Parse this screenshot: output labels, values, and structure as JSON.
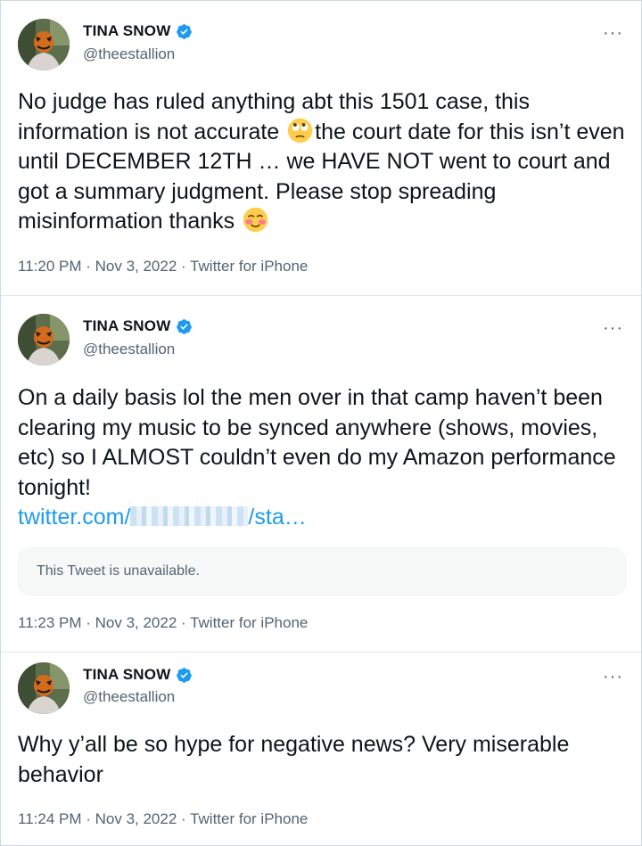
{
  "tweets": [
    {
      "name": "TINA SNOW",
      "handle": "@theestallion",
      "text_parts": [
        "No judge has ruled anything abt this 1501 case, this information is not accurate ",
        "the court date for this isn’t even until DECEMBER 12TH … we HAVE NOT went to court and got a summary judgment. Please stop spreading misinformation thanks "
      ],
      "emojis": [
        "eye-roll-emoji",
        "smiling-blush-emoji"
      ],
      "meta": "11:20 PM · Nov 3, 2022 · Twitter for iPhone"
    },
    {
      "name": "TINA SNOW",
      "handle": "@theestallion",
      "text": "On a daily basis lol the men over in that camp haven’t been clearing my music to be synced anywhere (shows, movies, etc) so I ALMOST couldn’t even do my Amazon performance tonight!",
      "link_prefix": "twitter.com/",
      "link_suffix": "/sta…",
      "quoted": "This Tweet is unavailable.",
      "meta": "11:23 PM · Nov 3, 2022 · Twitter for iPhone"
    },
    {
      "name": "TINA SNOW",
      "handle": "@theestallion",
      "text": "Why y’all be so hype for negative news? Very miserable behavior",
      "meta": "11:24 PM · Nov 3, 2022 · Twitter for iPhone"
    }
  ],
  "more_label": "···",
  "colors": {
    "verified": "#1d9bf0",
    "link": "#1d9bf0",
    "secondary_text": "#536471"
  }
}
